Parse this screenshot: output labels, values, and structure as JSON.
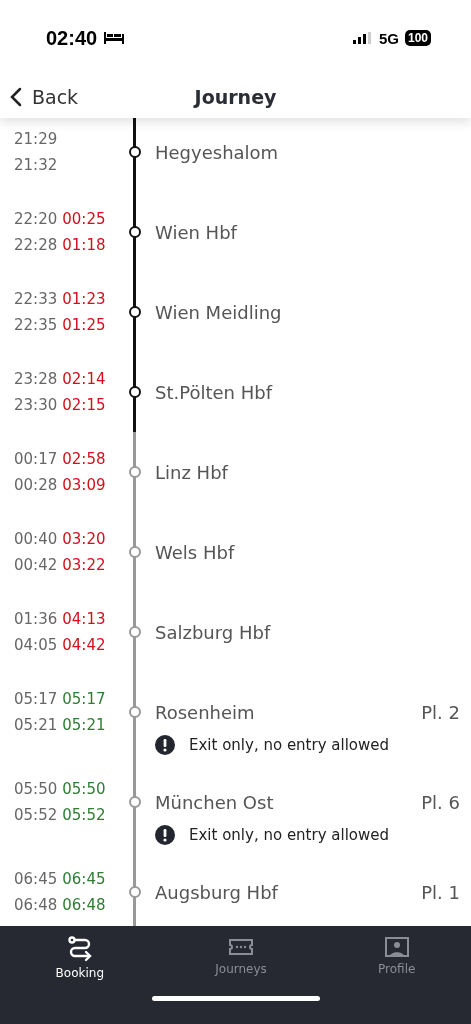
{
  "status_bar": {
    "time": "02:40",
    "network": "5G",
    "battery": "100"
  },
  "nav": {
    "back": "Back",
    "title": "Journey"
  },
  "stops": [
    {
      "station": "Hegyeshalom",
      "arrival": "21:29",
      "departure": "21:32",
      "passed": true
    },
    {
      "station": "Wien Hbf",
      "arrival": "22:20",
      "arrival_actual": "00:25",
      "departure": "22:28",
      "departure_actual": "01:18",
      "delayed": true,
      "passed": true
    },
    {
      "station": "Wien Meidling",
      "arrival": "22:33",
      "arrival_actual": "01:23",
      "departure": "22:35",
      "departure_actual": "01:25",
      "delayed": true,
      "passed": true
    },
    {
      "station": "St.Pölten Hbf",
      "arrival": "23:28",
      "arrival_actual": "02:14",
      "departure": "23:30",
      "departure_actual": "02:15",
      "delayed": true,
      "passed": true
    },
    {
      "station": "Linz Hbf",
      "arrival": "00:17",
      "arrival_actual": "02:58",
      "departure": "00:28",
      "departure_actual": "03:09",
      "delayed": true,
      "passed": false
    },
    {
      "station": "Wels Hbf",
      "arrival": "00:40",
      "arrival_actual": "03:20",
      "departure": "00:42",
      "departure_actual": "03:22",
      "delayed": true,
      "passed": false
    },
    {
      "station": "Salzburg Hbf",
      "arrival": "01:36",
      "arrival_actual": "04:13",
      "departure": "04:05",
      "departure_actual": "04:42",
      "delayed": true,
      "passed": false
    },
    {
      "station": "Rosenheim",
      "arrival": "05:17",
      "arrival_actual": "05:17",
      "departure": "05:21",
      "departure_actual": "05:21",
      "delayed": false,
      "passed": false,
      "platform": "Pl. 2",
      "notice": "Exit only, no entry allowed"
    },
    {
      "station": "München Ost",
      "arrival": "05:50",
      "arrival_actual": "05:50",
      "departure": "05:52",
      "departure_actual": "05:52",
      "delayed": false,
      "passed": false,
      "platform": "Pl. 6",
      "notice": "Exit only, no entry allowed"
    },
    {
      "station": "Augsburg Hbf",
      "arrival": "06:45",
      "arrival_actual": "06:45",
      "departure": "06:48",
      "departure_actual": "06:48",
      "delayed": false,
      "passed": false,
      "platform": "Pl. 1"
    }
  ],
  "tab_bar": [
    {
      "label": "Booking",
      "selected": true
    },
    {
      "label": "Journeys",
      "selected": false
    },
    {
      "label": "Profile",
      "selected": false
    }
  ]
}
